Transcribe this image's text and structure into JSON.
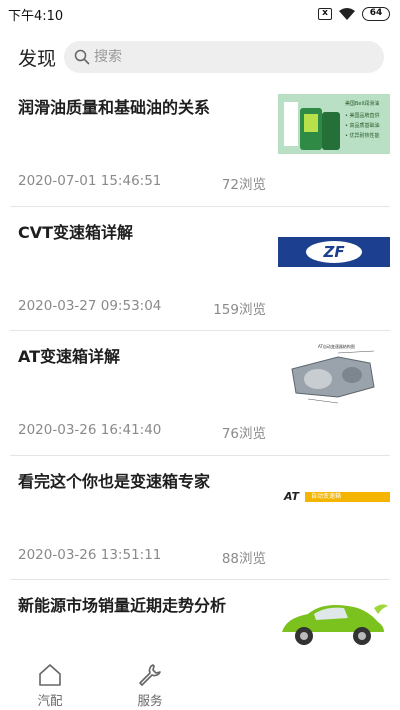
{
  "status_bar": {
    "time": "下午4:10",
    "box_label": "x",
    "battery": "64"
  },
  "header": {
    "title": "发现",
    "search_placeholder": "搜索"
  },
  "articles": [
    {
      "title": "润滑油质量和基础油的关系",
      "date": "2020-07-01 15:46:51",
      "views": "72浏览",
      "thumb_text": "美国Bell润滑油",
      "thumb_lines": [
        "• 美国品牌直供",
        "• 高品质基础油",
        "• 优异耐热性能"
      ]
    },
    {
      "title": "CVT变速箱详解",
      "date": "2020-03-27 09:53:04",
      "views": "159浏览",
      "thumb_text": "ZF"
    },
    {
      "title": "AT变速箱详解",
      "date": "2020-03-26 16:41:40",
      "views": "76浏览",
      "thumb_text": "AT自动变速器结构图"
    },
    {
      "title": "看完这个你也是变速箱专家",
      "date": "2020-03-26 13:51:11",
      "views": "88浏览",
      "thumb_text": "AT",
      "thumb_sub": "自动变速箱"
    },
    {
      "title": "新能源市场销量近期走势分析",
      "date": "",
      "views": ""
    }
  ],
  "tabbar": {
    "items": [
      {
        "label": "汽配"
      },
      {
        "label": "服务"
      }
    ]
  },
  "colors": {
    "divider": "#e5e5e5",
    "meta_text": "#8a8a8a",
    "search_bg": "#eeeeee",
    "zf_blue": "#1c3f8f",
    "ev_green": "#7cc21e"
  }
}
